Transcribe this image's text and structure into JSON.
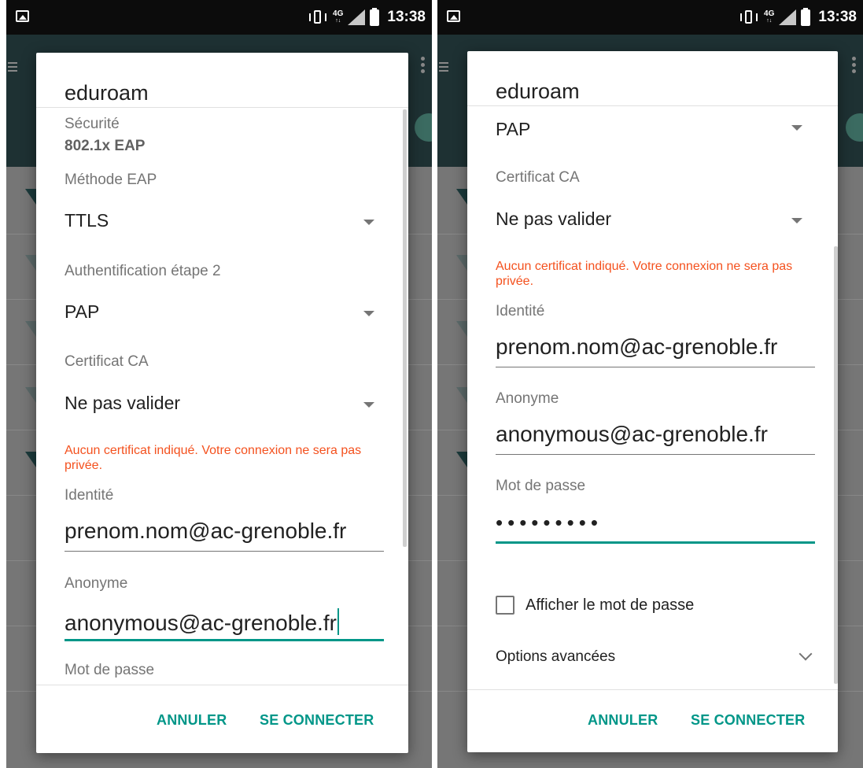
{
  "status_bar": {
    "network": "4G",
    "network_sub": "↑↓",
    "time": "13:38"
  },
  "dialog": {
    "title": "eduroam",
    "security_label": "Sécurité",
    "security_value": "802.1x EAP",
    "eap_method_label": "Méthode EAP",
    "eap_method_value": "TTLS",
    "phase2_label": "Authentification étape 2",
    "phase2_value": "PAP",
    "ca_cert_label": "Certificat CA",
    "ca_cert_value": "Ne pas valider",
    "warning": "Aucun certificat indiqué. Votre connexion ne sera pas privée.",
    "identity_label": "Identité",
    "identity_value": "prenom.nom@ac-grenoble.fr",
    "anonymous_label": "Anonyme",
    "anonymous_value": "anonymous@ac-grenoble.fr",
    "password_label": "Mot de passe",
    "password_value": "•••••••••",
    "show_password_label": "Afficher le mot de passe",
    "advanced_options_label": "Options avancées",
    "cancel_button": "ANNULER",
    "connect_button": "SE CONNECTER"
  },
  "colors": {
    "accent": "#009688",
    "warning": "#f4511e",
    "appbar": "#1e3133"
  }
}
